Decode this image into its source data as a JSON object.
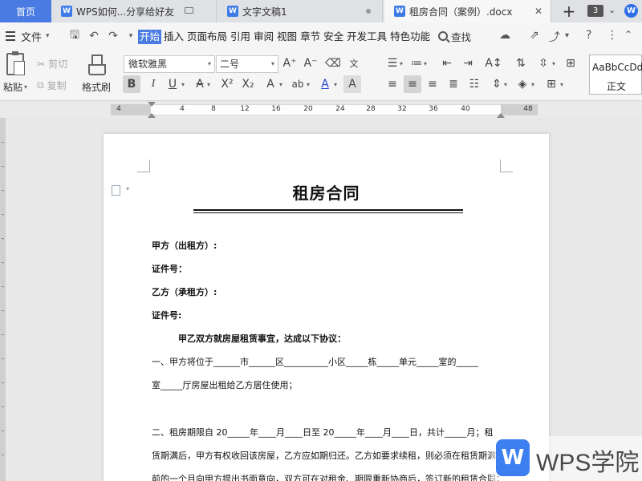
{
  "tabs": {
    "home": "首页",
    "docs": [
      {
        "label": "WPS如何...分享给好友",
        "active": false
      },
      {
        "label": "文字文稿1",
        "active": false
      },
      {
        "label": "租房合同（案例）.docx",
        "active": true
      }
    ],
    "count": "3"
  },
  "menu": {
    "file": "文件",
    "items": [
      "开始",
      "插入",
      "页面布局",
      "引用",
      "审阅",
      "视图",
      "章节",
      "安全",
      "开发工具",
      "特色功能"
    ],
    "active_index": 0,
    "search": "查找"
  },
  "ribbon": {
    "paste": "粘贴",
    "cut": "剪切",
    "copy": "复制",
    "format_painter": "格式刷",
    "font_name": "微软雅黑",
    "font_size": "二号",
    "style_sample": "AaBbCcDd",
    "style_name": "正文"
  },
  "ruler": {
    "labels": [
      "4",
      "4",
      "8",
      "12",
      "16",
      "20",
      "24",
      "28",
      "32",
      "36",
      "40",
      "48"
    ]
  },
  "document": {
    "title": "租房合同",
    "lines": [
      "甲方（出租方）:",
      "证件号：",
      "乙方（承租方）:",
      "证件号:",
      "甲乙双方就房屋租赁事宜，达成以下协议：",
      "一、甲方将位于______市______区__________小区_____栋_____单元_____室的_____",
      "室_____厅房屋出租给乙方居住使用；",
      "二、租房期限自 20_____年____月____日至 20_____年____月____日，共计_____月；租",
      "赁期满后，甲方有权收回该房屋，乙方应如期归还。乙方如要求续租，则必须在租赁期满",
      "前的一个月向甲方提出书面意向，双方可在对租金、期限重新协商后，签订新的租赁合同；"
    ]
  },
  "watermark": {
    "logo": "W",
    "text": "WPS学院"
  }
}
